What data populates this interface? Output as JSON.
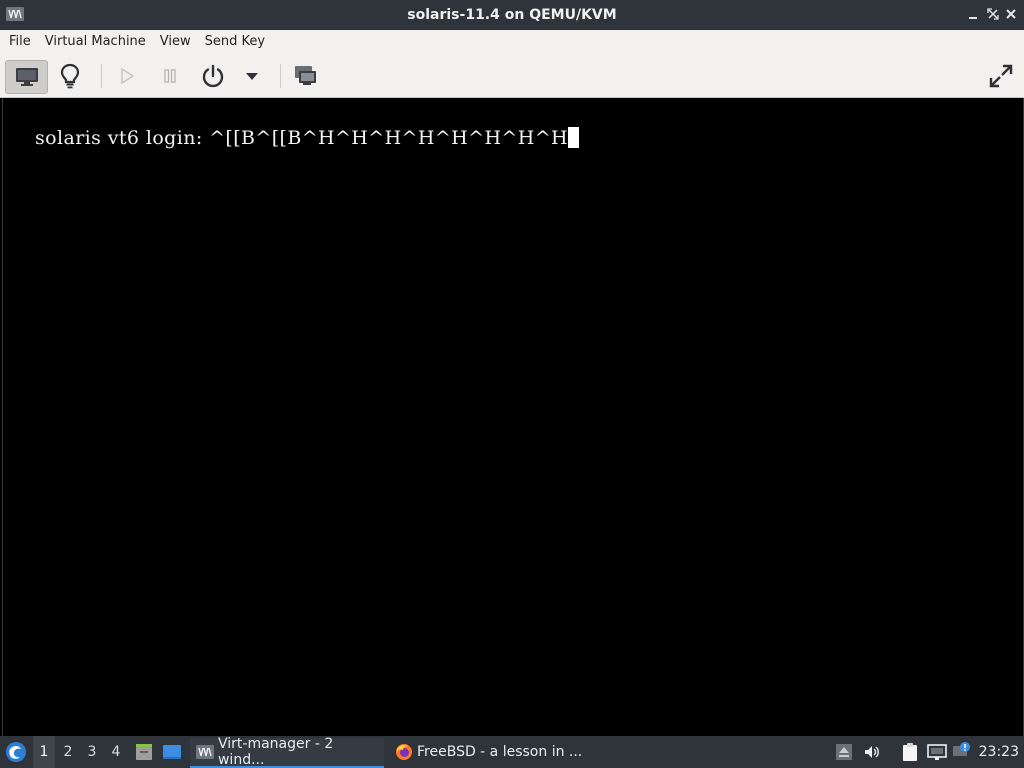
{
  "window": {
    "title": "solaris-11.4 on QEMU/KVM",
    "controls": [
      "minimize-icon",
      "restore-icon",
      "close-icon"
    ]
  },
  "menubar": {
    "items": [
      {
        "label": "File"
      },
      {
        "label": "Virtual Machine"
      },
      {
        "label": "View"
      },
      {
        "label": "Send Key"
      }
    ]
  },
  "toolbar": {
    "buttons": [
      {
        "icon": "monitor-icon",
        "active": true
      },
      {
        "icon": "lightbulb-icon"
      },
      {
        "icon": "play-icon",
        "enabled": false
      },
      {
        "icon": "pause-icon",
        "enabled": false
      },
      {
        "icon": "power-icon"
      },
      {
        "icon": "chevron-down-icon"
      },
      {
        "icon": "snapshots-icon"
      },
      {
        "icon": "fullscreen-icon"
      }
    ]
  },
  "console": {
    "text": "solaris vt6 login: ^[[B^[[B^H^H^H^H^H^H^H^H"
  },
  "taskbar": {
    "workspaces": [
      "1",
      "2",
      "3",
      "4"
    ],
    "active_workspace": "1",
    "tasks": [
      {
        "label": "Virt-manager - 2 wind...",
        "icon": "virt-manager-icon",
        "active": true
      },
      {
        "label": "FreeBSD - a lesson in ...",
        "icon": "firefox-icon",
        "active": false
      }
    ],
    "clock": "23:23"
  },
  "colors": {
    "titlebar": "#2f343b",
    "menubar": "#f2f1f0",
    "console_bg": "#000000",
    "console_fg": "#f4f4f4",
    "accent": "#3c8ee5"
  }
}
